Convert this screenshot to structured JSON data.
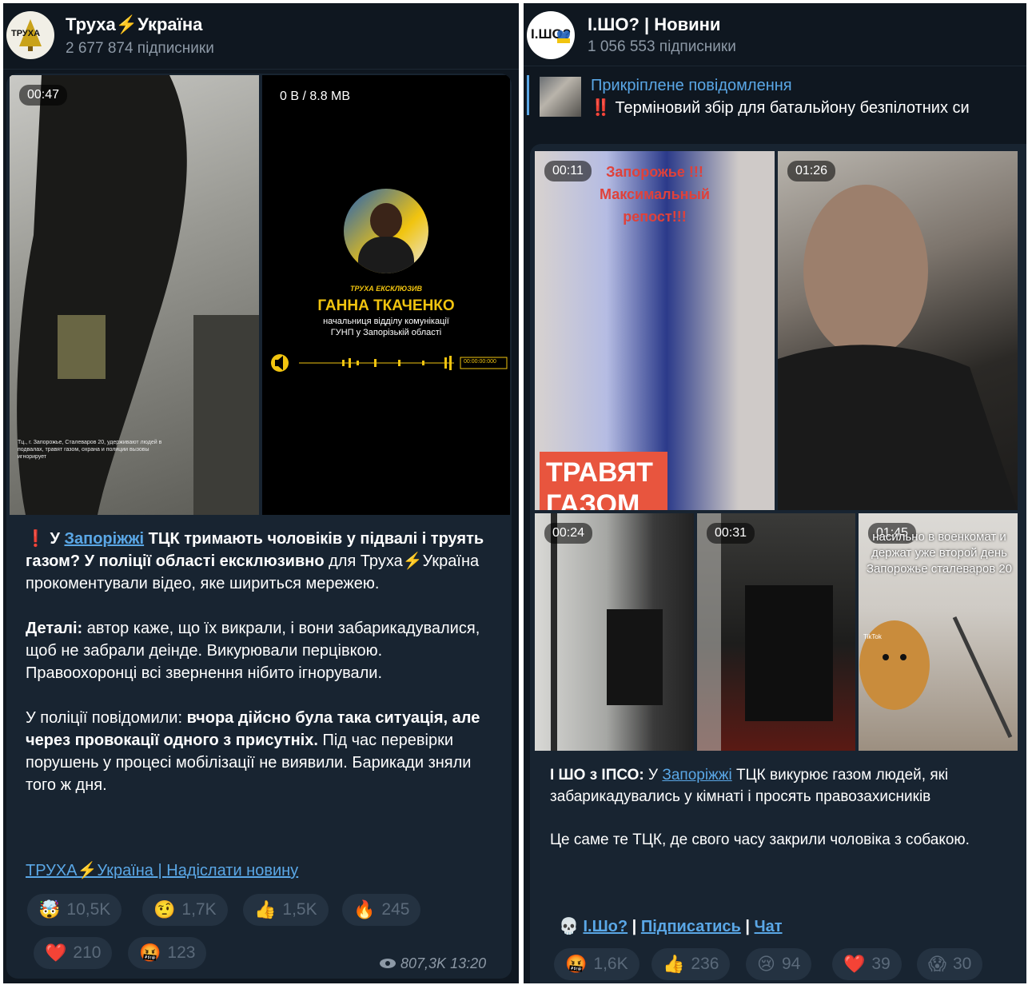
{
  "left": {
    "channel": {
      "name": "Труха⚡️Україна",
      "subscribers": "2 677 874 підписники",
      "avatar_text": "ТРУХА"
    },
    "media": [
      {
        "duration": "00:47",
        "overlay_caption": "Тц., г. Запорожье, Сталеваров 20, удерживают людей в подвалах, травят газом, охрана и полиции вызовы игнорирует"
      },
      {
        "size_label": "0 B / 8.8 MB",
        "brand": "ТРУХА ЕКСКЛЮЗИВ",
        "person_name": "ГАННА ТКАЧЕНКО",
        "person_role_line1": "начальниця відділу комунікації",
        "person_role_line2": "ГУНП у Запорізькій області",
        "player_time": "00:00:00:000"
      }
    ],
    "text": {
      "p1_mark": "❗️",
      "p1_a": "У ",
      "p1_link": "Запоріжжі",
      "p1_b": " ТЦК тримають чоловіків у підвалі і труять газом? У поліції області ексклюзивно",
      "p1_c": " для Труха⚡️Україна прокоментували відео, яке шириться мережею.",
      "p2_bold": "Деталі:",
      "p2_rest": " автор каже, що їх викрали, і вони забарикадувалися, щоб не забрали деінде. Викурювали перцівкою. Правоохоронці всі звернення нібито ігнорували.",
      "p3_a": "У поліції повідомили: ",
      "p3_bold": "вчора дійсно була така ситуація, але через провокації одного з присутніх.",
      "p3_rest": " Під час перевірки порушень у процесі мобілізації не виявили. Барикади зняли того ж дня."
    },
    "signature": {
      "link1": "ТРУХА⚡️Україна",
      "sep": " | ",
      "link2": "Надіслати новину"
    },
    "reactions": [
      {
        "emoji": "🤯",
        "count": "10,5K"
      },
      {
        "emoji": "🤨",
        "count": "1,7K"
      },
      {
        "emoji": "👍",
        "count": "1,5K"
      },
      {
        "emoji": "🔥",
        "count": "245"
      },
      {
        "emoji": "❤️",
        "count": "210"
      },
      {
        "emoji": "🤬",
        "count": "123"
      }
    ],
    "views": "807,3K 13:20"
  },
  "right": {
    "channel": {
      "name": "І.ШО? | Новини",
      "subscribers": "1 056 553 підписники",
      "avatar_text": "І.ШО?"
    },
    "pinned": {
      "label": "Прикріплене повідомлення",
      "text": "‼️ Терміновий збір для батальйону безпілотних си"
    },
    "media": [
      {
        "duration": "00:11",
        "overlay_top": "Запорожье !!! Максимальный репост!!!",
        "overlay_big": "ТРАВЯТ ГАЗОМ"
      },
      {
        "duration": "01:26"
      },
      {
        "duration": "00:24"
      },
      {
        "duration": "00:31"
      },
      {
        "duration": "01:45",
        "overlay_text": "насильно в военкомат и держат уже второй день Запорожье сталеваров 20",
        "tiktok": "TikTok"
      }
    ],
    "text": {
      "p1_bold": "І ШО з ІПСО:",
      "p1_a": " У ",
      "p1_link": "Запоріжжі",
      "p1_rest": " ТЦК викурює газом людей, які забарикадувались у кімнаті і просять правозахисників",
      "p2": "Це саме те ТЦК, де свого часу закрили чоловіка з собакою."
    },
    "signature": {
      "icon": "💀",
      "link1": "І.Шо?",
      "sep1": " | ",
      "link2": "Підписатись",
      "sep2": " | ",
      "link3": "Чат"
    },
    "reactions": [
      {
        "emoji": "🤬",
        "count": "1,6K"
      },
      {
        "emoji": "👍",
        "count": "236"
      },
      {
        "emoji": "😢",
        "count": "94"
      },
      {
        "emoji": "❤️",
        "count": "39"
      },
      {
        "emoji": "😱",
        "count": "30"
      }
    ]
  },
  "colors": {
    "panel_bg": "#0f1720",
    "bubble_bg": "#182431",
    "link": "#5aa7e6",
    "reaction_bg": "#243241",
    "muted": "#8d99a6"
  }
}
